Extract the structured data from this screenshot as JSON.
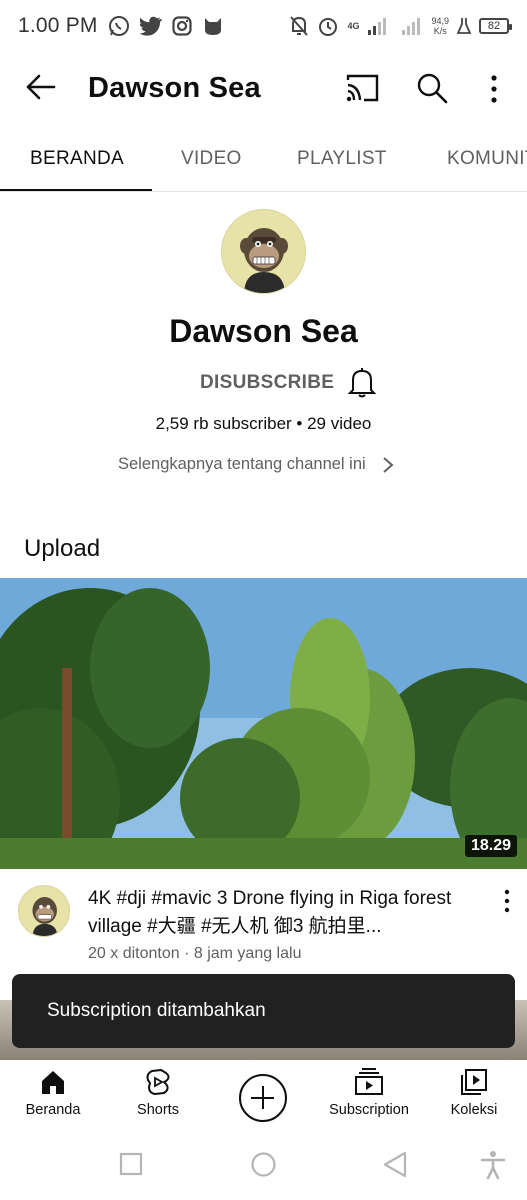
{
  "status_bar": {
    "time": "1.00 PM",
    "app_icons": [
      "whatsapp-icon",
      "twitter-icon",
      "instagram-icon",
      "cat-icon"
    ],
    "network": "4G",
    "speed_value": "94,9",
    "speed_unit": "K/s",
    "battery": "82"
  },
  "app_bar": {
    "title": "Dawson Sea",
    "icons": [
      "back-arrow-icon",
      "cast-icon",
      "search-icon",
      "more-vertical-icon"
    ]
  },
  "tabs": [
    {
      "label": "BERANDA",
      "active": true
    },
    {
      "label": "VIDEO",
      "active": false
    },
    {
      "label": "PLAYLIST",
      "active": false
    },
    {
      "label": "KOMUNITAS",
      "active": false
    }
  ],
  "channel": {
    "name": "Dawson Sea",
    "subscribe_label": "DISUBSCRIBE",
    "stats": "2,59 rb subscriber • 29 video",
    "more_about": "Selengkapnya tentang channel ini"
  },
  "section": {
    "title": "Upload"
  },
  "video": {
    "duration": "18.29",
    "title": "4K #dji #mavic 3 Drone flying in Riga forest village #大疆 #无人机 御3 航拍里...",
    "meta": "20 x ditonton · 8 jam yang lalu"
  },
  "snackbar": {
    "message": "Subscription ditambahkan"
  },
  "bottom_nav": [
    {
      "label": "Beranda",
      "icon": "home-icon"
    },
    {
      "label": "Shorts",
      "icon": "shorts-icon"
    },
    {
      "label": "",
      "icon": "create-icon"
    },
    {
      "label": "Subscription",
      "icon": "subscriptions-icon"
    },
    {
      "label": "Koleksi",
      "icon": "library-icon"
    }
  ],
  "system_nav": [
    "recents-icon",
    "home-circle-icon",
    "back-triangle-icon",
    "accessibility-icon"
  ]
}
